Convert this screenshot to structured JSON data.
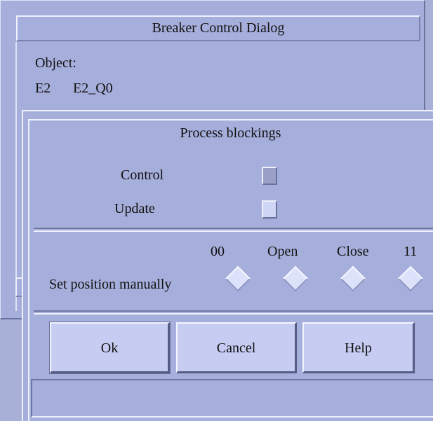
{
  "breaker_dialog": {
    "title": "Breaker Control Dialog",
    "object_label": "Object:",
    "station": "E2",
    "object_id": "E2_Q0"
  },
  "process_blockings": {
    "title": "Process blockings",
    "control_label": "Control",
    "update_label": "Update",
    "control_checked": true,
    "update_checked": false
  },
  "manual_position": {
    "label": "Set position manually",
    "options": [
      "00",
      "Open",
      "Close",
      "11"
    ]
  },
  "buttons": {
    "ok": "Ok",
    "cancel": "Cancel",
    "help": "Help"
  },
  "status_bar": {
    "text": ""
  },
  "colors": {
    "dialog_bg": "#a6aedb",
    "button_bg": "#c7cdf2",
    "highlight": "#eef0fb",
    "shadow": "#6a719b"
  }
}
